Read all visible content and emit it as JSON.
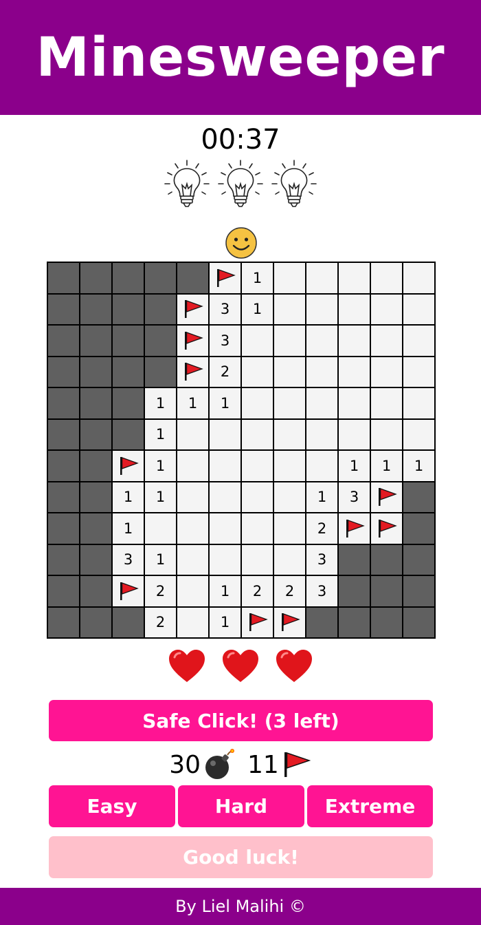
{
  "title": "Minesweeper",
  "timer": "00:37",
  "hints_count": 3,
  "lives_count": 3,
  "smiley": "smiley-face-icon",
  "board": [
    [
      "#",
      "#",
      "#",
      "#",
      "#",
      "F",
      "1",
      ".",
      ".",
      ".",
      ".",
      "."
    ],
    [
      "#",
      "#",
      "#",
      "#",
      "F",
      "3",
      "1",
      ".",
      ".",
      ".",
      ".",
      "."
    ],
    [
      "#",
      "#",
      "#",
      "#",
      "F",
      "3",
      ".",
      ".",
      ".",
      ".",
      ".",
      "."
    ],
    [
      "#",
      "#",
      "#",
      "#",
      "F",
      "2",
      ".",
      ".",
      ".",
      ".",
      ".",
      "."
    ],
    [
      "#",
      "#",
      "#",
      "1",
      "1",
      "1",
      ".",
      ".",
      ".",
      ".",
      ".",
      "."
    ],
    [
      "#",
      "#",
      "#",
      "1",
      ".",
      ".",
      ".",
      ".",
      ".",
      ".",
      ".",
      "."
    ],
    [
      "#",
      "#",
      "F",
      "1",
      ".",
      ".",
      ".",
      ".",
      ".",
      "1",
      "1",
      "1"
    ],
    [
      "#",
      "#",
      "1",
      "1",
      ".",
      ".",
      ".",
      ".",
      "1",
      "3",
      "F",
      "#"
    ],
    [
      "#",
      "#",
      "1",
      ".",
      ".",
      ".",
      ".",
      ".",
      "2",
      "F",
      "F",
      "#"
    ],
    [
      "#",
      "#",
      "3",
      "1",
      ".",
      ".",
      ".",
      ".",
      "3",
      "#",
      "#",
      "#"
    ],
    [
      "#",
      "#",
      "F",
      "2",
      ".",
      "1",
      "2",
      "2",
      "3",
      "#",
      "#",
      "#"
    ],
    [
      "#",
      "#",
      "#",
      "2",
      ".",
      "1",
      "F",
      "F",
      "#",
      "#",
      "#",
      "#"
    ]
  ],
  "buttons": {
    "safe_click": "Safe Click! (3 left)",
    "easy": "Easy",
    "hard": "Hard",
    "extreme": "Extreme"
  },
  "counts": {
    "mines": "30",
    "flags": "11"
  },
  "status": "Good luck!",
  "footer": "By Liel Malihi ©",
  "colors": {
    "header_bg": "#8b008b",
    "button_bg": "#ff1493",
    "status_bg": "#ffc0cb",
    "hidden_cell": "#606060",
    "open_cell": "#f4f4f4"
  }
}
